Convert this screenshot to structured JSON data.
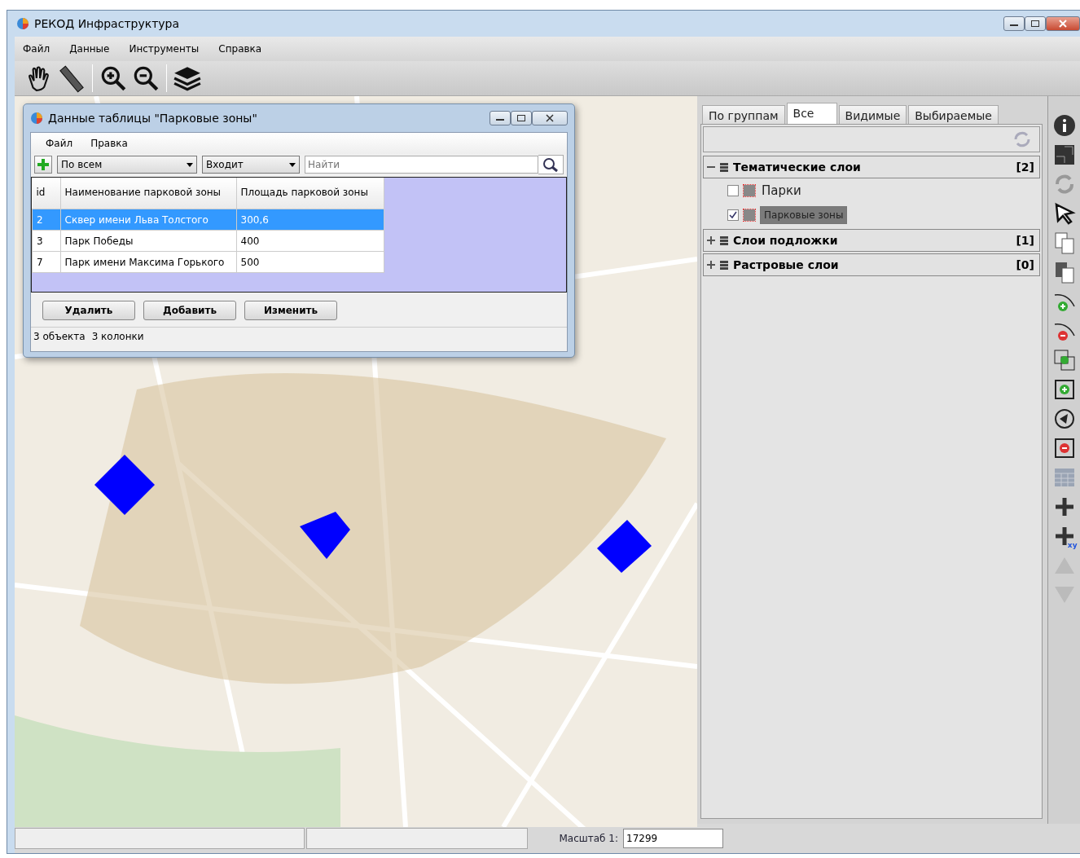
{
  "window": {
    "title": "РЕКОД Инфраструктура"
  },
  "menu": [
    "Файл",
    "Данные",
    "Инструменты",
    "Справка"
  ],
  "dialog": {
    "title": "Данные таблицы \"Парковые зоны\"",
    "menu": [
      "Файл",
      "Правка"
    ],
    "field_select": "По всем",
    "operator_select": "Входит",
    "search": {
      "placeholder": "Найти"
    },
    "table": {
      "columns": [
        "id",
        "Наименование парковой зоны",
        "Площадь парковой зоны"
      ],
      "rows": [
        {
          "cells": [
            "2",
            "Сквер имени Льва Толстого",
            "300,6"
          ],
          "selected": true
        },
        {
          "cells": [
            "3",
            "Парк Победы",
            "400"
          ],
          "selected": false
        },
        {
          "cells": [
            "7",
            "Парк имени Максима Горького",
            "500"
          ],
          "selected": false
        }
      ]
    },
    "buttons": [
      "Удалить",
      "Добавить",
      "Изменить"
    ],
    "status": [
      "3 объекта",
      "3 колонки"
    ]
  },
  "layer_panel": {
    "tabs": [
      {
        "label": "По группам",
        "selected": false
      },
      {
        "label": "Все",
        "selected": true
      },
      {
        "label": "Видимые",
        "selected": false
      },
      {
        "label": "Выбираемые",
        "selected": false
      }
    ],
    "groups": [
      {
        "label": "Тематические слои",
        "count": "[2]",
        "expanded": true,
        "children": [
          {
            "label": "Парки",
            "checked": false,
            "selected": false
          },
          {
            "label": "Парковые зоны",
            "checked": true,
            "selected": true
          }
        ]
      },
      {
        "label": "Слои подложки",
        "count": "[1]",
        "expanded": false
      },
      {
        "label": "Растровые слои",
        "count": "[0]",
        "expanded": false
      }
    ]
  },
  "side_toolbar": {
    "xy_label": "xy"
  },
  "status_bar": {
    "scale_label": "Масштаб 1:",
    "scale_value": "17299"
  }
}
